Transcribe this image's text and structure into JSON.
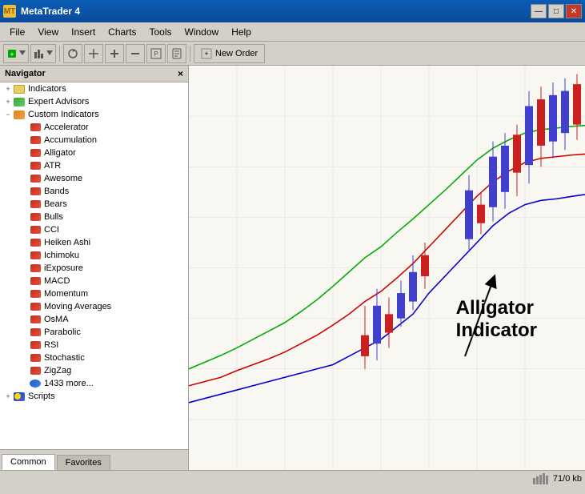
{
  "titleBar": {
    "appIcon": "MT",
    "title": "MetaTrader 4",
    "btnMinimize": "—",
    "btnMaximize": "□",
    "btnClose": "✕"
  },
  "menuBar": {
    "items": [
      "File",
      "View",
      "Insert",
      "Charts",
      "Tools",
      "Window",
      "Help"
    ]
  },
  "toolbar": {
    "newOrderLabel": "New Order"
  },
  "navigator": {
    "title": "Navigator",
    "closeBtn": "×",
    "tree": [
      {
        "id": "indicators",
        "label": "Indicators",
        "level": 0,
        "type": "folder",
        "toggle": "+"
      },
      {
        "id": "expert-advisors",
        "label": "Expert Advisors",
        "level": 0,
        "type": "expert",
        "toggle": "+"
      },
      {
        "id": "custom-indicators",
        "label": "Custom Indicators",
        "level": 0,
        "type": "custom",
        "toggle": "−"
      },
      {
        "id": "accelerator",
        "label": "Accelerator",
        "level": 1,
        "type": "ind"
      },
      {
        "id": "accumulation",
        "label": "Accumulation",
        "level": 1,
        "type": "ind"
      },
      {
        "id": "alligator",
        "label": "Alligator",
        "level": 1,
        "type": "ind"
      },
      {
        "id": "atr",
        "label": "ATR",
        "level": 1,
        "type": "ind"
      },
      {
        "id": "awesome",
        "label": "Awesome",
        "level": 1,
        "type": "ind"
      },
      {
        "id": "bands",
        "label": "Bands",
        "level": 1,
        "type": "ind"
      },
      {
        "id": "bears",
        "label": "Bears",
        "level": 1,
        "type": "ind"
      },
      {
        "id": "bulls",
        "label": "Bulls",
        "level": 1,
        "type": "ind"
      },
      {
        "id": "cci",
        "label": "CCI",
        "level": 1,
        "type": "ind"
      },
      {
        "id": "heiken-ashi",
        "label": "Heiken Ashi",
        "level": 1,
        "type": "ind"
      },
      {
        "id": "ichimoku",
        "label": "Ichimoku",
        "level": 1,
        "type": "ind"
      },
      {
        "id": "iexposure",
        "label": "iExposure",
        "level": 1,
        "type": "ind"
      },
      {
        "id": "macd",
        "label": "MACD",
        "level": 1,
        "type": "ind"
      },
      {
        "id": "momentum",
        "label": "Momentum",
        "level": 1,
        "type": "ind"
      },
      {
        "id": "moving-averages",
        "label": "Moving Averages",
        "level": 1,
        "type": "ind"
      },
      {
        "id": "osma",
        "label": "OsMA",
        "level": 1,
        "type": "ind"
      },
      {
        "id": "parabolic",
        "label": "Parabolic",
        "level": 1,
        "type": "ind"
      },
      {
        "id": "rsi",
        "label": "RSI",
        "level": 1,
        "type": "ind"
      },
      {
        "id": "stochastic",
        "label": "Stochastic",
        "level": 1,
        "type": "ind"
      },
      {
        "id": "zigzag",
        "label": "ZigZag",
        "level": 1,
        "type": "ind"
      },
      {
        "id": "more",
        "label": "1433 more...",
        "level": 1,
        "type": "ind"
      },
      {
        "id": "scripts",
        "label": "Scripts",
        "level": 0,
        "type": "scripts",
        "toggle": "+"
      }
    ],
    "tabs": [
      "Common",
      "Favorites"
    ]
  },
  "chartAnnotation": {
    "line1": "Alligator",
    "line2": "Indicator"
  },
  "statusBar": {
    "bars": "71/0 kb"
  },
  "colors": {
    "chartBg": "#f5f5f0",
    "lineBlue": "#0000ff",
    "lineRed": "#ff0000",
    "lineGreen": "#00aa00",
    "candleUp": "#4040cc",
    "candleDown": "#cc2020"
  }
}
